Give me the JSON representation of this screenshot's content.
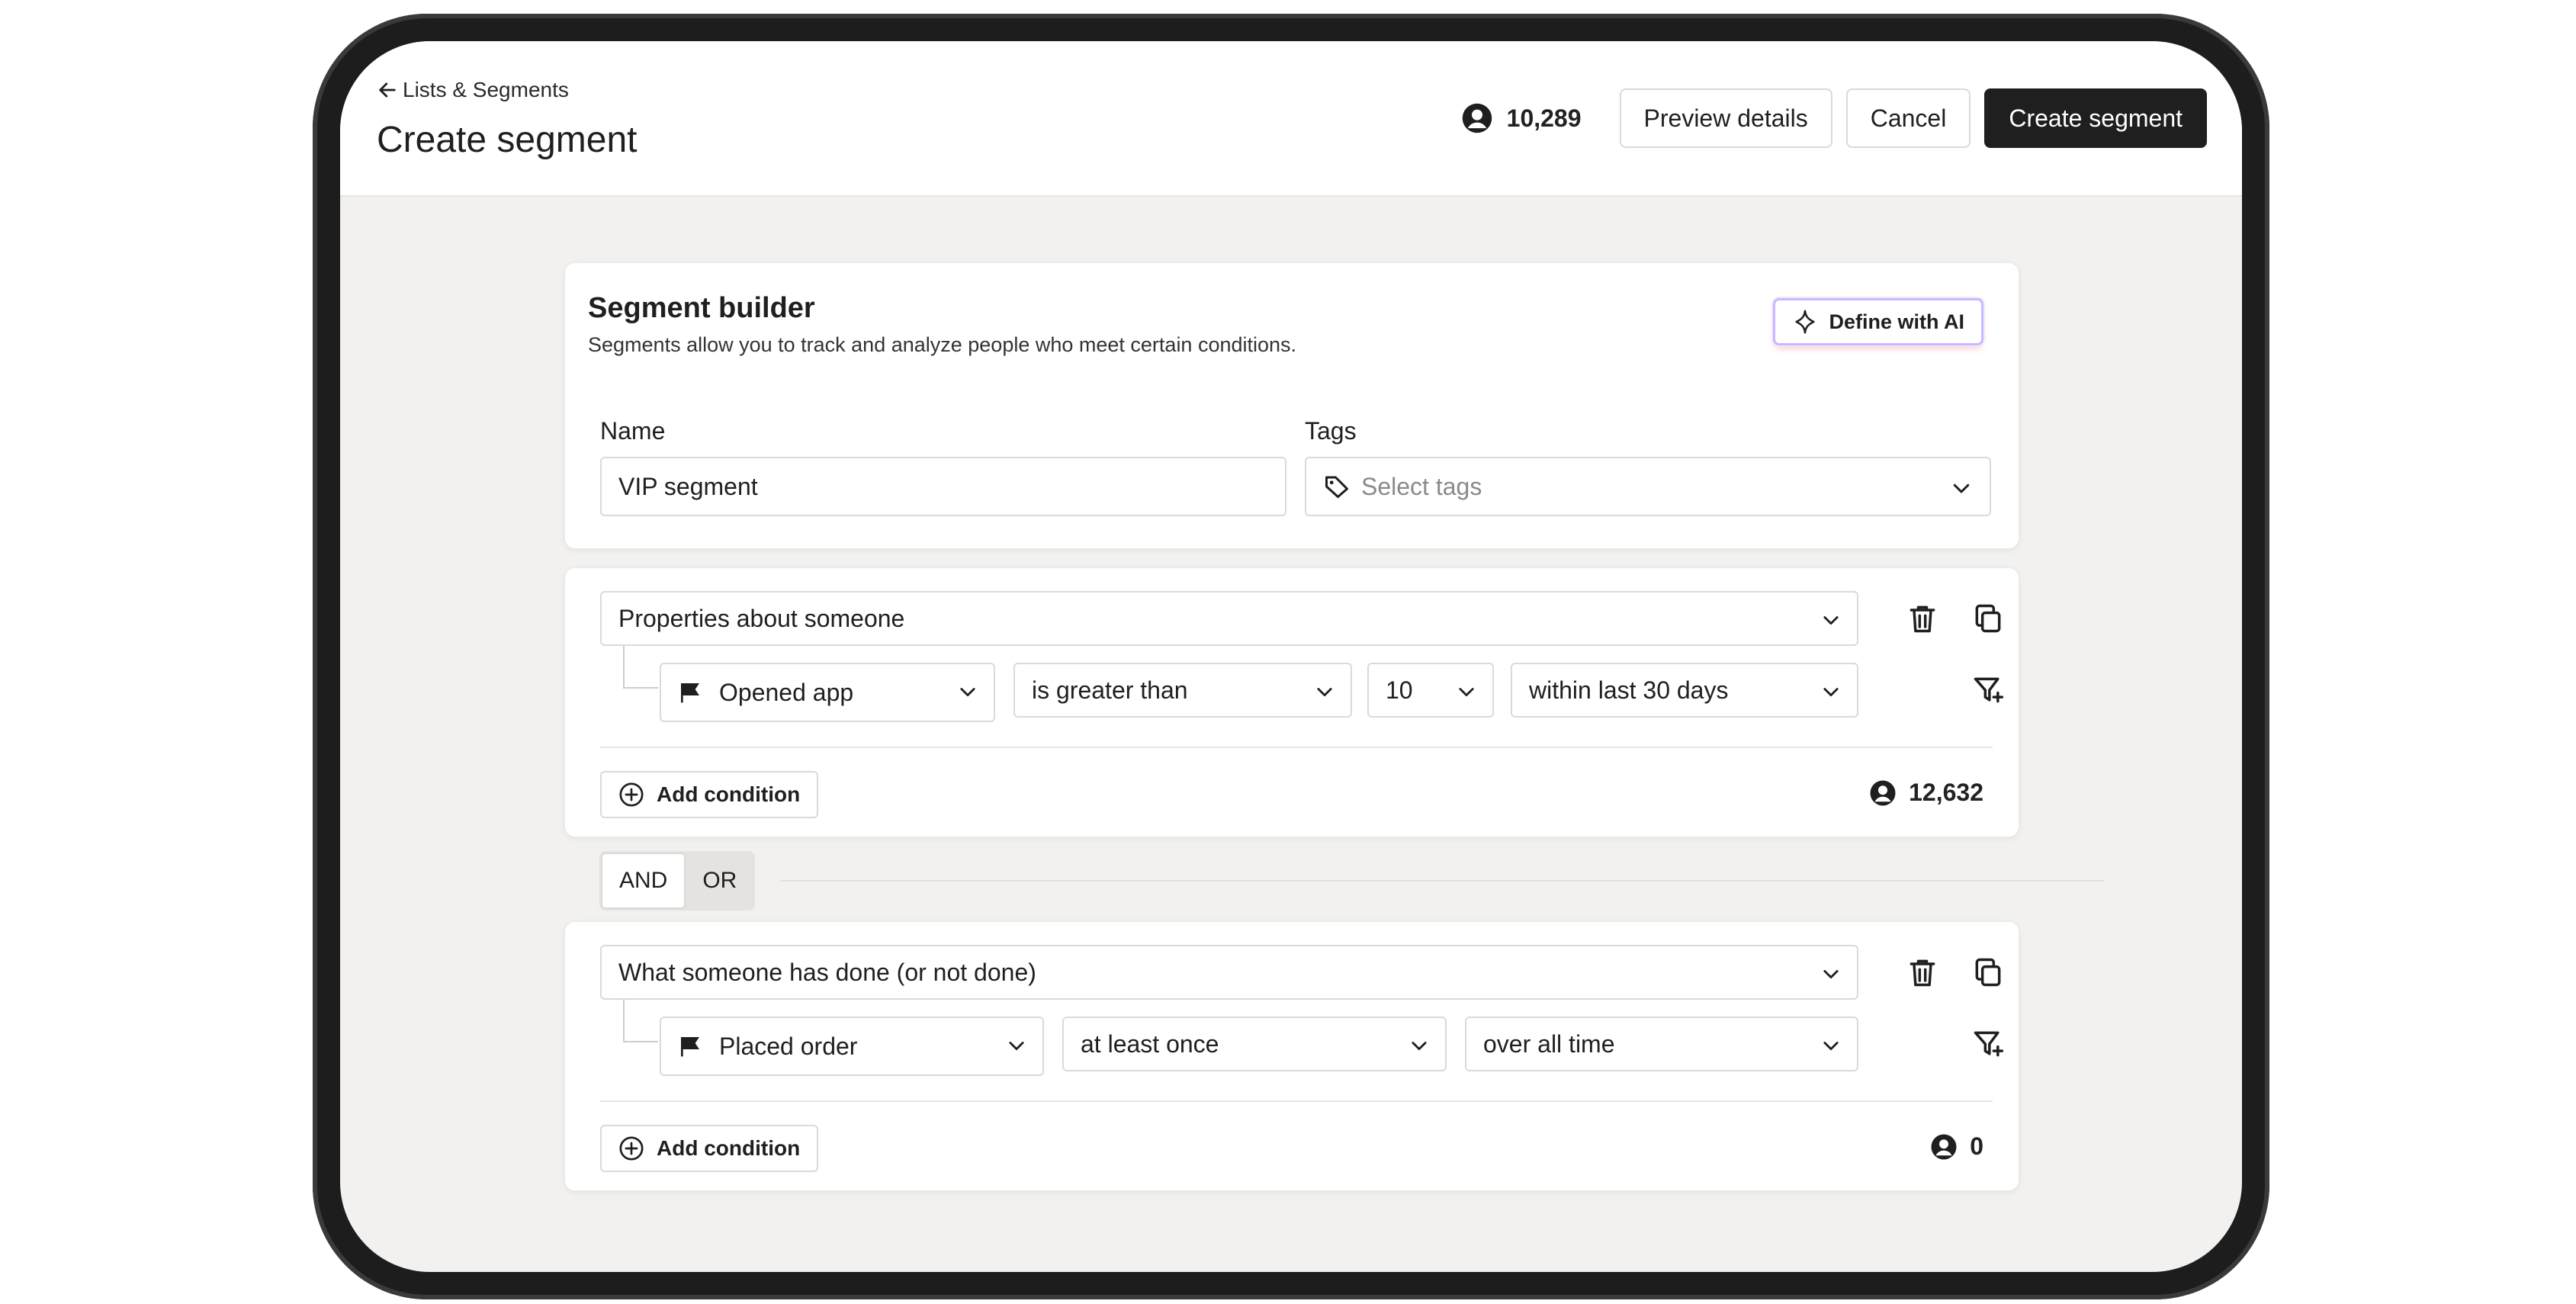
{
  "header": {
    "back_label": "Lists & Segments",
    "title": "Create segment",
    "count": "10,289",
    "preview_label": "Preview details",
    "cancel_label": "Cancel",
    "create_label": "Create segment"
  },
  "builder": {
    "title": "Segment builder",
    "subtitle": "Segments allow you to track and analyze people who meet certain conditions.",
    "ai_label": "Define with AI",
    "name_label": "Name",
    "name_value": "VIP segment",
    "tags_label": "Tags",
    "tags_placeholder": "Select tags"
  },
  "rules": [
    {
      "type": "Properties about someone",
      "event": "Opened app",
      "operator": "is greater than",
      "value": "10",
      "timeframe": "within last 30 days",
      "add_label": "Add condition",
      "count": "12,632"
    },
    {
      "type": "What someone has done (or not done)",
      "event": "Placed order",
      "operator": "at least once",
      "timeframe": "over all time",
      "add_label": "Add condition",
      "count": "0"
    }
  ],
  "logic": {
    "and_label": "AND",
    "or_label": "OR",
    "selected": "AND"
  },
  "icons": {
    "back": "arrow-left-icon",
    "person": "person-circle-icon",
    "ai": "sparkle-icon",
    "tag": "tag-icon",
    "chevron": "chevron-down-icon",
    "flag": "flag-icon",
    "delete": "trash-icon",
    "duplicate": "copy-icon",
    "filter": "filter-add-icon",
    "add": "plus-circle-icon"
  }
}
